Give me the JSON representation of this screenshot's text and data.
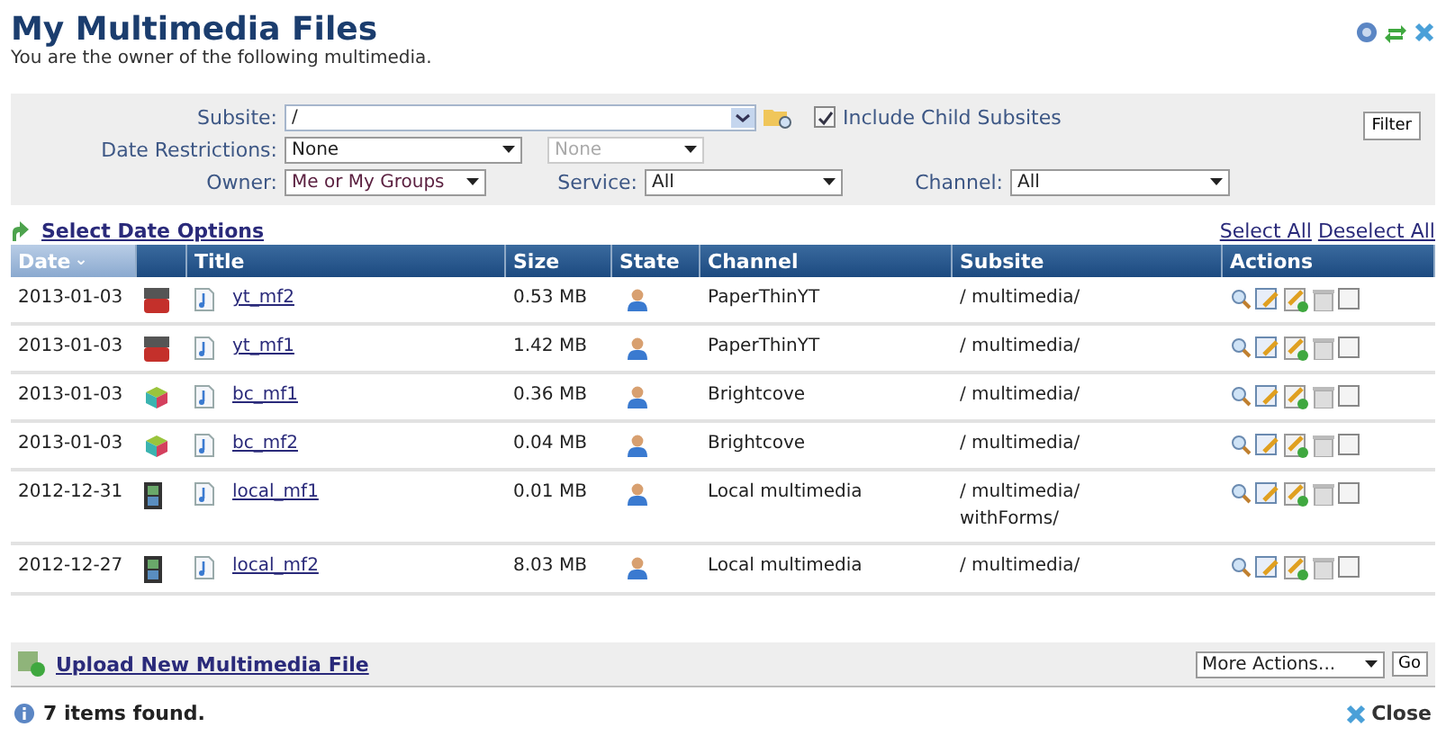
{
  "header": {
    "title": "My Multimedia Files",
    "subtitle": "You are the owner of the following multimedia."
  },
  "filters": {
    "subsite_label": "Subsite:",
    "subsite_value": "/",
    "include_child": {
      "label": "Include Child Subsites",
      "checked": true
    },
    "filter_button": "Filter",
    "date_label": "Date Restrictions:",
    "date_value": "None",
    "date_value_2": {
      "value": "None",
      "disabled": true
    },
    "owner_label": "Owner:",
    "owner_value": "Me or My Groups",
    "service_label": "Service:",
    "service_value": "All",
    "channel_label": "Channel:",
    "channel_value": "All"
  },
  "links": {
    "select_date_options": "Select Date Options",
    "select_all": "Select All",
    "deselect_all": "Deselect All"
  },
  "table": {
    "columns": [
      "Date",
      "",
      "Title",
      "Size",
      "State",
      "Channel",
      "Subsite",
      "Actions"
    ],
    "sort_indicator": "⌄",
    "rows": [
      {
        "date": "2013-01-03",
        "kind": "youtube",
        "title": "yt_mf2",
        "size": "0.53 MB",
        "channel": "PaperThinYT",
        "subsite": [
          "/ multimedia/"
        ],
        "checked": false
      },
      {
        "date": "2013-01-03",
        "kind": "youtube",
        "title": "yt_mf1",
        "size": "1.42 MB",
        "channel": "PaperThinYT",
        "subsite": [
          "/ multimedia/"
        ],
        "checked": false
      },
      {
        "date": "2013-01-03",
        "kind": "brightcove",
        "title": "bc_mf1",
        "size": "0.36 MB",
        "channel": "Brightcove",
        "subsite": [
          "/ multimedia/"
        ],
        "checked": false
      },
      {
        "date": "2013-01-03",
        "kind": "brightcove",
        "title": "bc_mf2",
        "size": "0.04 MB",
        "channel": "Brightcove",
        "subsite": [
          "/ multimedia/"
        ],
        "checked": false
      },
      {
        "date": "2012-12-31",
        "kind": "local",
        "title": "local_mf1",
        "size": "0.01 MB",
        "channel": "Local multimedia",
        "subsite": [
          "/ multimedia/",
          "withForms/"
        ],
        "checked": false
      },
      {
        "date": "2012-12-27",
        "kind": "local",
        "title": "local_mf2",
        "size": "8.03 MB",
        "channel": "Local multimedia",
        "subsite": [
          "/ multimedia/"
        ],
        "checked": false
      }
    ]
  },
  "bottom_bar": {
    "upload_link": "Upload New Multimedia File",
    "more_actions": "More Actions...",
    "go_button": "Go"
  },
  "status": {
    "message": "7 items found.",
    "close": "Close"
  }
}
